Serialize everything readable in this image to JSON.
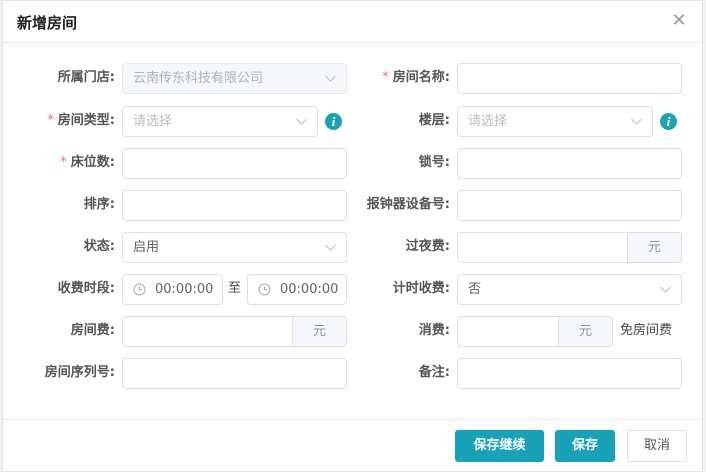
{
  "dialog": {
    "title": "新增房间"
  },
  "form": {
    "store": {
      "label": "所属门店:",
      "value": "云南传东科技有限公司"
    },
    "room_name": {
      "label": "房间名称:",
      "value": ""
    },
    "room_type": {
      "label": "房间类型:",
      "placeholder": "请选择"
    },
    "floor": {
      "label": "楼层:",
      "placeholder": "请选择"
    },
    "beds": {
      "label": "床位数:",
      "value": ""
    },
    "lock": {
      "label": "锁号:",
      "value": ""
    },
    "sort": {
      "label": "排序:",
      "value": ""
    },
    "alarm_device": {
      "label": "报钟器设备号:",
      "value": ""
    },
    "status": {
      "label": "状态:",
      "value": "启用"
    },
    "overnight_fee": {
      "label": "过夜费:",
      "unit": "元"
    },
    "charge_period": {
      "label": "收费时段:",
      "start": "00:00:00",
      "to": "至",
      "end": "00:00:00"
    },
    "hourly": {
      "label": "计时收费:",
      "value": "否"
    },
    "room_fee": {
      "label": "房间费:",
      "unit": "元"
    },
    "consumption": {
      "label": "消费:",
      "unit": "元",
      "note": "免房间费"
    },
    "room_serial": {
      "label": "房间序列号:",
      "value": ""
    },
    "remark": {
      "label": "备注:",
      "value": ""
    }
  },
  "buttons": {
    "save_continue": "保存继续",
    "save": "保存",
    "cancel": "取消"
  },
  "colors": {
    "accent": "#17a2b8",
    "required": "#f56c6c"
  }
}
